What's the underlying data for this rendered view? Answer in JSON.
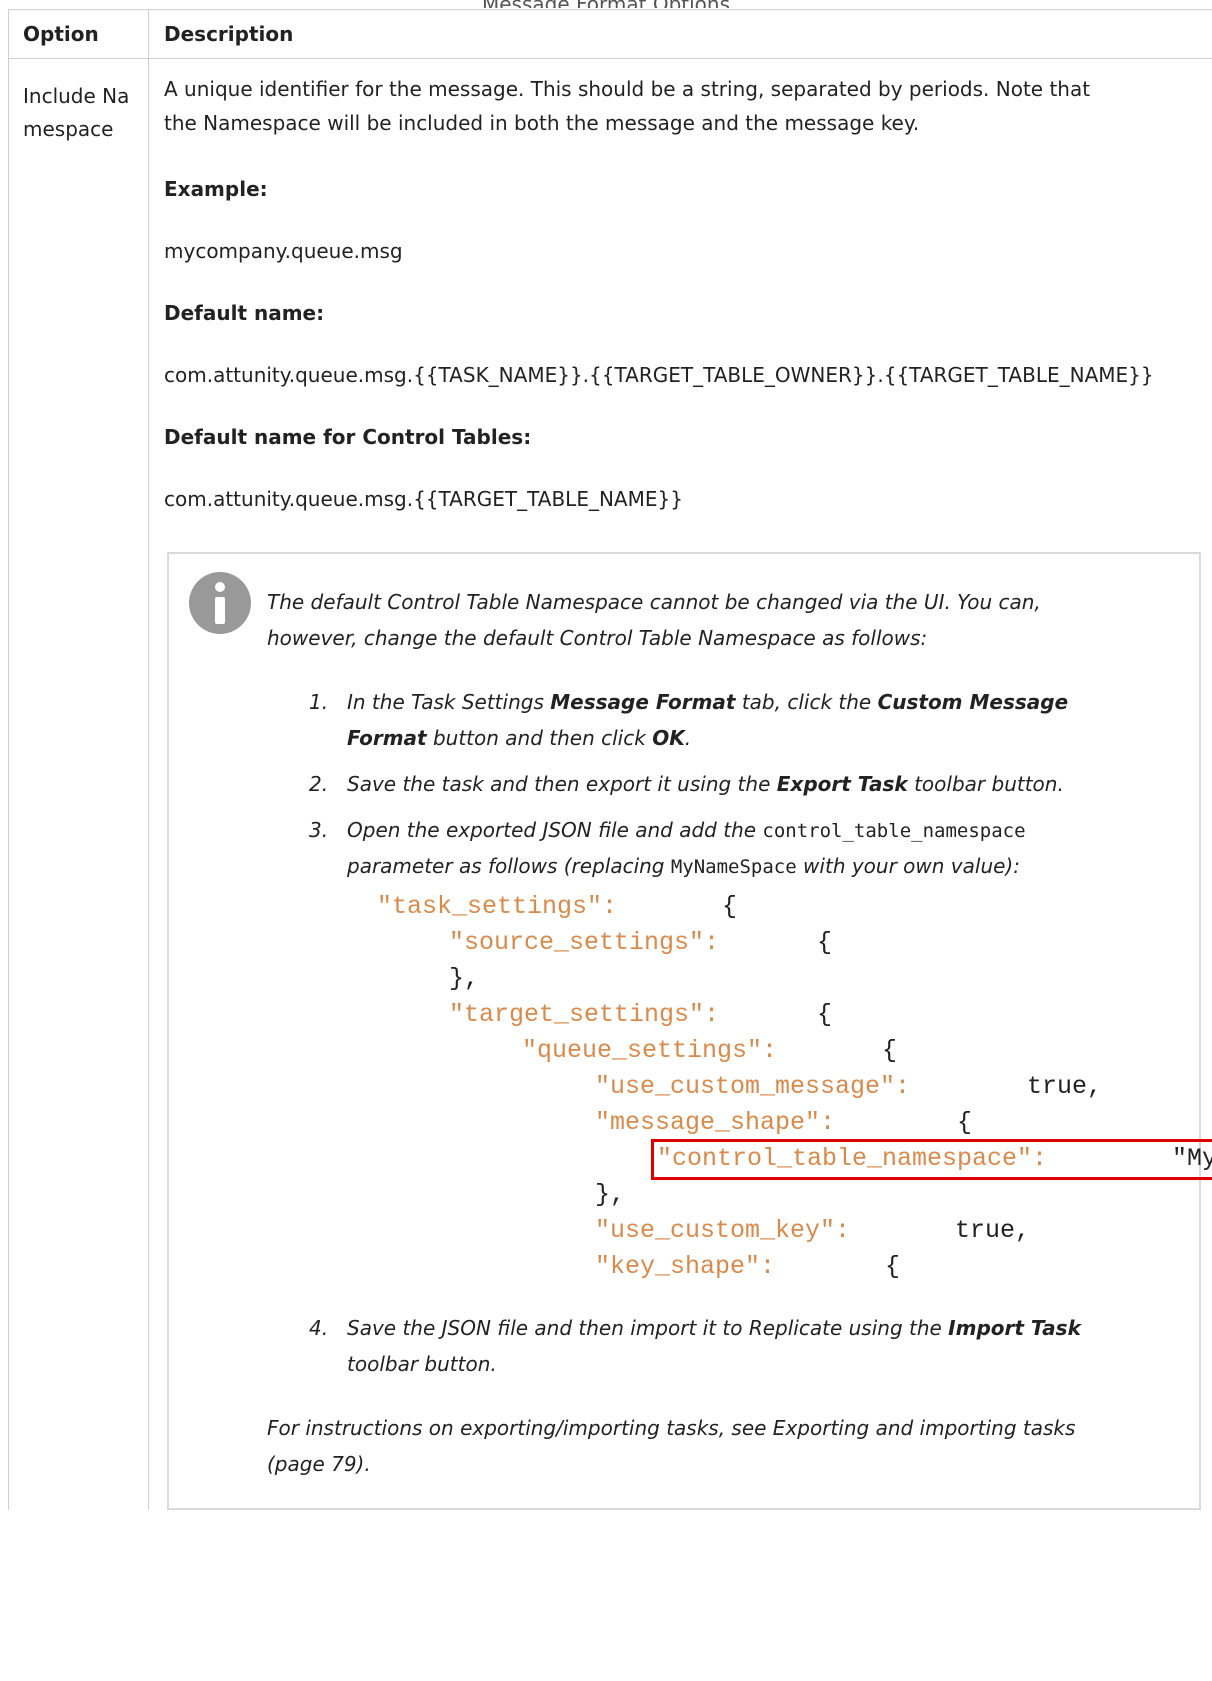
{
  "header": {
    "caption": "Message Format Options",
    "col_option": "Option",
    "col_description": "Description"
  },
  "row": {
    "option": "Include Namespace",
    "desc_line1": "A unique identifier for the message. This should be a string, separated by periods. Note that",
    "desc_line2": "the Namespace will be included in both the message and the message key.",
    "example_label": "Example:",
    "example_value": "mycompany.queue.msg",
    "default_label": "Default name:",
    "default_value": "com.attunity.queue.msg.{{TASK_NAME}}.{{TARGET_TABLE_OWNER}}.{{TARGET_TABLE_NAME}}",
    "control_label": "Default name for Control Tables:",
    "control_value": "com.attunity.queue.msg.{{TARGET_TABLE_NAME}}"
  },
  "note": {
    "line1": "The default Control Table Namespace cannot be changed via the UI. You can,",
    "line2": "however, change the default Control Table Namespace as follows:",
    "steps": [
      {
        "num": "1.",
        "a": "In the Task Settings ",
        "b": "Message Format",
        "c": " tab, click the ",
        "d": "Custom Message",
        "e2": "Format",
        "f": " button and then click ",
        "g": "OK",
        "h": "."
      },
      {
        "num": "2.",
        "a": "Save the task and then export it using the ",
        "b": "Export Task",
        "c": " toolbar button."
      },
      {
        "num": "3.",
        "a": "Open the exported JSON file and add the ",
        "code1": "control_table_namespace",
        "b": "parameter as follows (replacing ",
        "code2": "MyNameSpace",
        "c": " with your own value):"
      },
      {
        "num": "4.",
        "a": "Save the JSON file and then import it to Replicate using the ",
        "b": "Import Task",
        "c": "toolbar button."
      }
    ],
    "footer1": "For instructions on exporting/importing tasks, see Exporting and importing tasks",
    "footer2": "(page 79)."
  },
  "code": {
    "l1k": "\"task_settings\":",
    "l1p": "{",
    "l2k": "\"source_settings\":",
    "l2p": "{",
    "l3p": "},",
    "l4k": "\"target_settings\":",
    "l4p": "{",
    "l5k": "\"queue_settings\":",
    "l5p": "{",
    "l6k": "\"use_custom_message\":",
    "l6p": "true,",
    "l7k": "\"message_shape\":",
    "l7p": "{",
    "l8k": "\"control_table_namespace\":",
    "l8p": "\"My",
    "l9p": "},",
    "l10k": "\"use_custom_key\":",
    "l10p": "true,",
    "l11k": "\"key_shape\":",
    "l11p": "{"
  }
}
